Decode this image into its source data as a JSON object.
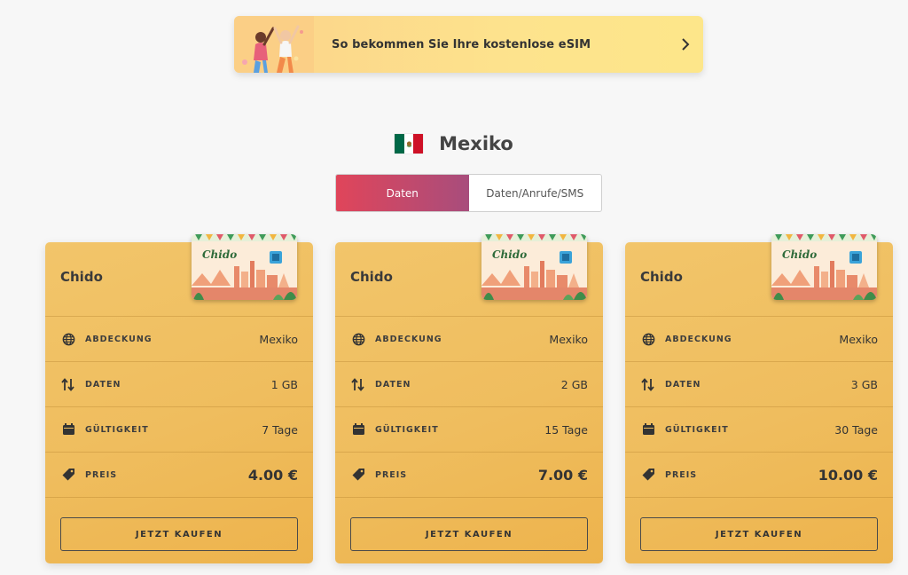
{
  "banner": {
    "text": "So bekommen Sie Ihre kostenlose eSIM",
    "illustration_icon": "people-celebrating-illustration",
    "chevron_icon": "chevron-right-icon",
    "colors": {
      "from": "#fcd38a",
      "to": "#fde68a"
    }
  },
  "country": {
    "name": "Mexiko",
    "flag_icon": "mexico-flag-icon",
    "flag_colors": [
      "#006847",
      "#ffffff",
      "#ce1126"
    ]
  },
  "tabs": [
    {
      "label": "Daten",
      "active": true
    },
    {
      "label": "Daten/Anrufe/SMS",
      "active": false
    }
  ],
  "accent": {
    "active_tab_from": "#e0455a",
    "active_tab_to": "#a84d7c",
    "card": "#efbd5e"
  },
  "row_labels": {
    "coverage": "ABDECKUNG",
    "data": "DATEN",
    "validity": "GÜLTIGKEIT",
    "price": "PREIS"
  },
  "plans": [
    {
      "title": "Chido",
      "sim_label": "Chido",
      "coverage": "Mexiko",
      "data": "1 GB",
      "validity": "7 Tage",
      "price": "4.00 €",
      "button": "JETZT KAUFEN"
    },
    {
      "title": "Chido",
      "sim_label": "Chido",
      "coverage": "Mexiko",
      "data": "2 GB",
      "validity": "15 Tage",
      "price": "7.00 €",
      "button": "JETZT KAUFEN"
    },
    {
      "title": "Chido",
      "sim_label": "Chido",
      "coverage": "Mexiko",
      "data": "3 GB",
      "validity": "30 Tage",
      "price": "10.00 €",
      "button": "JETZT KAUFEN"
    }
  ]
}
